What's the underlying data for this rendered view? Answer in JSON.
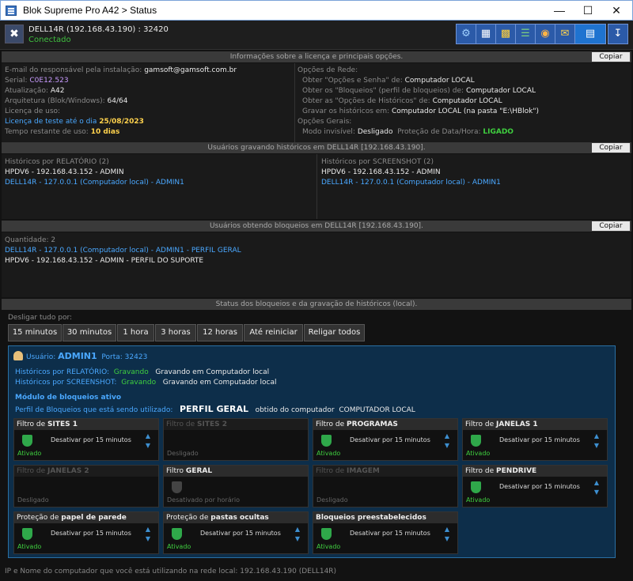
{
  "window": {
    "title": "Blok Supreme Pro A42 > Status"
  },
  "header": {
    "host": "DELL14R (192.168.43.190) : 32420",
    "status": "Conectado"
  },
  "license": {
    "bar_title": "Informações sobre a licença e principais opções.",
    "copy_label": "Copiar",
    "email_label": "E-mail do responsável pela instalação:",
    "email_value": "gamsoft@gamsoft.com.br",
    "serial_label": "Serial:",
    "serial_value": "C0E12.523",
    "update_label": "Atualização:",
    "update_value": "A42",
    "arch_label": "Arquitetura (Blok/Windows):",
    "arch_value": "64/64",
    "license_label": "Licença de uso:",
    "trial_label": "Licença de teste até o dia",
    "trial_value": "25/08/2023",
    "remaining_label": "Tempo restante de uso:",
    "remaining_value": "10 dias",
    "net_title": "Opções de Rede:",
    "net1_label": "Obter \"Opções e Senha\" de:",
    "net1_value": "Computador LOCAL",
    "net2_label": "Obter os \"Bloqueios\" (perfil de bloqueios) de:",
    "net2_value": "Computador LOCAL",
    "net3_label": "Obter as \"Opções de Históricos\" de:",
    "net3_value": "Computador LOCAL",
    "net4_label": "Gravar os históricos em:",
    "net4_value": "Computador LOCAL (na pasta \"E:\\HBlok\")",
    "gen_title": "Opções Gerais:",
    "invis_label": "Modo invisível:",
    "invis_value": "Desligado",
    "prot_label": "Proteção de Data/Hora:",
    "prot_value": "LIGADO"
  },
  "history": {
    "bar_title": "Usuários gravando históricos em DELL14R [192.168.43.190].",
    "copy_label": "Copiar",
    "report_title": "Históricos por RELATÓRIO (2)",
    "report_items": [
      "HPDV6 - 192.168.43.152 - ADMIN",
      "DELL14R - 127.0.0.1 (Computador local) - ADMIN1"
    ],
    "screenshot_title": "Históricos por SCREENSHOT (2)",
    "screenshot_items": [
      "HPDV6 - 192.168.43.152 - ADMIN",
      "DELL14R - 127.0.0.1 (Computador local) - ADMIN1"
    ]
  },
  "blocks": {
    "bar_title": "Usuários obtendo bloqueios em DELL14R [192.168.43.190].",
    "copy_label": "Copiar",
    "quantity": "Quantidade: 2",
    "items": [
      "DELL14R - 127.0.0.1 (Computador local) - ADMIN1 - PERFIL GERAL",
      "HPDV6 - 192.168.43.152 - ADMIN - PERFIL DO SUPORTE"
    ]
  },
  "status": {
    "bar_title": "Status dos bloqueios e da gravação de históricos (local).",
    "off_label": "Desligar tudo por:",
    "durations": [
      "15 minutos",
      "30 minutos",
      "1 hora",
      "3 horas",
      "12 horas",
      "Até reiniciar",
      "Religar todos"
    ],
    "user_label": "Usuário:",
    "user_value": "ADMIN1",
    "port_label": "Porta:",
    "port_value": "32423",
    "rep_label": "Históricos por RELATÓRIO:",
    "rep_state": "Gravando",
    "rep_desc": "Gravando em Computador local",
    "shot_label": "Históricos por SCREENSHOT:",
    "shot_state": "Gravando",
    "shot_desc": "Gravando em Computador local",
    "module_active": "Módulo de bloqueios ativo",
    "profile_label": "Perfil de Bloqueios que está sendo utilizado:",
    "profile_value": "PERFIL GERAL",
    "profile_src_label": "obtido do computador",
    "profile_src_value": "COMPUTADOR LOCAL"
  },
  "cards": [
    {
      "pre": "Filtro de ",
      "bold": "SITES 1",
      "action": "Desativar por 15 minutos",
      "state": "Ativado",
      "enabled": true
    },
    {
      "pre": "Filtro de ",
      "bold": "SITES 2",
      "action": "",
      "state": "Desligado",
      "enabled": false
    },
    {
      "pre": "Filtro de ",
      "bold": "PROGRAMAS",
      "action": "Desativar por 15 minutos",
      "state": "Ativado",
      "enabled": true
    },
    {
      "pre": "Filtro de ",
      "bold": "JANELAS 1",
      "action": "Desativar por 15 minutos",
      "state": "Ativado",
      "enabled": true
    },
    {
      "pre": "Filtro de ",
      "bold": "JANELAS 2",
      "action": "",
      "state": "Desligado",
      "enabled": false
    },
    {
      "pre": "Filtro ",
      "bold": "GERAL",
      "action": "",
      "state": "Desativado por horário",
      "enabled": true
    },
    {
      "pre": "Filtro de ",
      "bold": "IMAGEM",
      "action": "",
      "state": "Desligado",
      "enabled": false
    },
    {
      "pre": "Filtro de ",
      "bold": "PENDRIVE",
      "action": "Desativar por 15 minutos",
      "state": "Ativado",
      "enabled": true
    },
    {
      "pre": "Proteção de ",
      "bold": "papel de parede",
      "action": "Desativar por 15 minutos",
      "state": "Ativado",
      "enabled": true
    },
    {
      "pre": "Proteção de ",
      "bold": "pastas ocultas",
      "action": "Desativar por 15 minutos",
      "state": "Ativado",
      "enabled": true
    },
    {
      "pre": "",
      "bold": "Bloqueios preestabelecidos",
      "action": "Desativar por 15 minutos",
      "state": "Ativado",
      "enabled": true
    }
  ],
  "footer": {
    "text": "IP e Nome do computador que você está utilizando na rede local: 192.168.43.190 (DELL14R)"
  }
}
